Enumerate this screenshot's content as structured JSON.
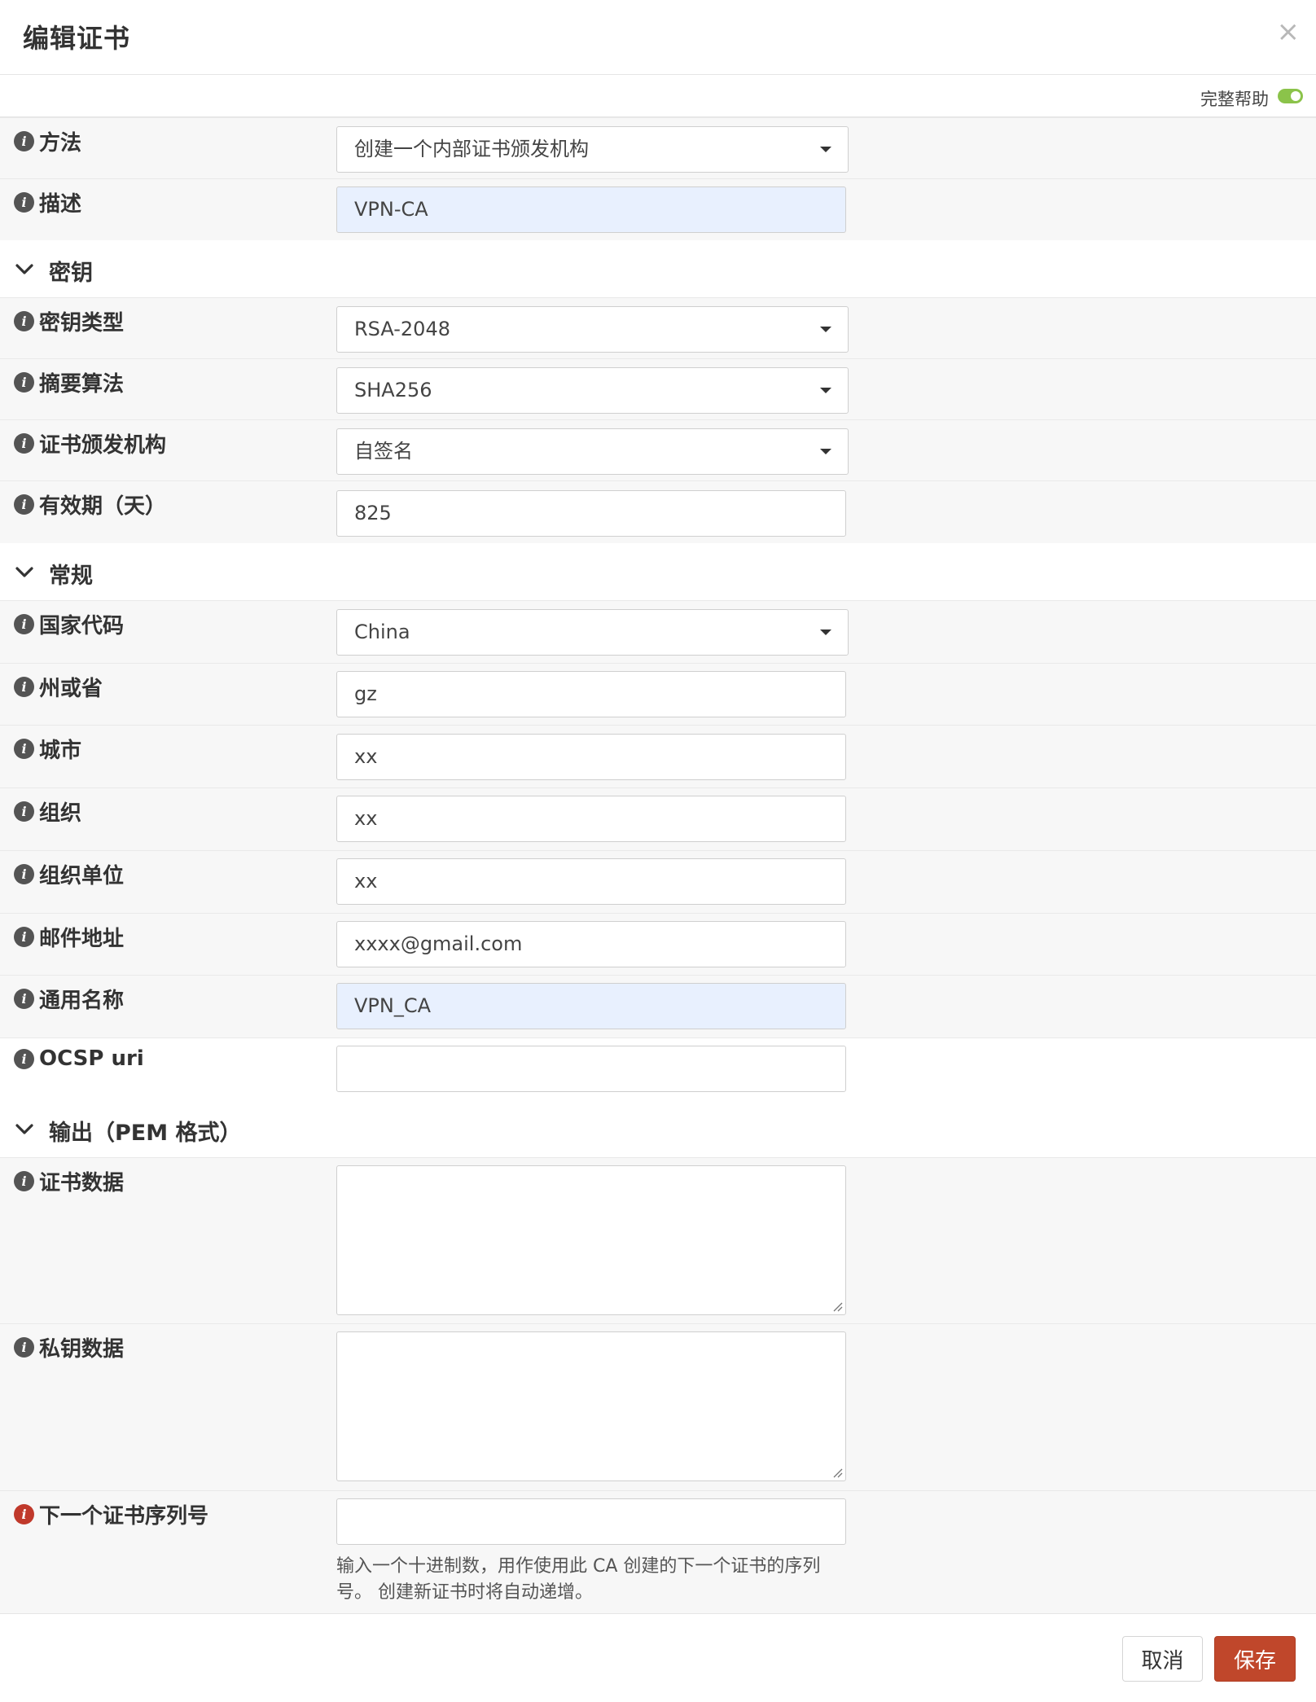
{
  "dialog": {
    "title": "编辑证书",
    "close_glyph": "×"
  },
  "help": {
    "label": "完整帮助",
    "enabled": true
  },
  "fields": {
    "method": {
      "label": "方法",
      "value": "创建一个内部证书颁发机构"
    },
    "description": {
      "label": "描述",
      "value": "VPN-CA"
    },
    "key_type": {
      "label": "密钥类型",
      "value": "RSA-2048"
    },
    "digest": {
      "label": "摘要算法",
      "value": "SHA256"
    },
    "issuer": {
      "label": "证书颁发机构",
      "value": "自签名"
    },
    "lifetime": {
      "label": "有效期（天）",
      "value": "825"
    },
    "country": {
      "label": "国家代码",
      "value": "China"
    },
    "state": {
      "label": "州或省",
      "value": "gz"
    },
    "city": {
      "label": "城市",
      "value": "xx"
    },
    "organization": {
      "label": "组织",
      "value": "xx"
    },
    "org_unit": {
      "label": "组织单位",
      "value": "xx"
    },
    "email": {
      "label": "邮件地址",
      "value": "xxxx@gmail.com"
    },
    "common_name": {
      "label": "通用名称",
      "value": "VPN_CA"
    },
    "ocsp_uri": {
      "label": "OCSP uri",
      "value": ""
    },
    "cert_data": {
      "label": "证书数据",
      "value": ""
    },
    "private_key": {
      "label": "私钥数据",
      "value": ""
    },
    "serial": {
      "label": "下一个证书序列号",
      "value": "",
      "hint_line1": "输入一个十进制数，用作使用此 CA 创建的下一个证书的序列",
      "hint_line2": "号。 创建新证书时将自动递增。"
    }
  },
  "sections": {
    "keys": "密钥",
    "general": "常规",
    "output": "输出（PEM 格式）"
  },
  "footer": {
    "cancel": "取消",
    "save": "保存"
  },
  "colors": {
    "save_button": "#c0472b",
    "toggle_on": "#8bc34a",
    "autofill_bg": "#e8f0fe",
    "info_icon": "#545454",
    "info_icon_error": "#c0392b"
  }
}
